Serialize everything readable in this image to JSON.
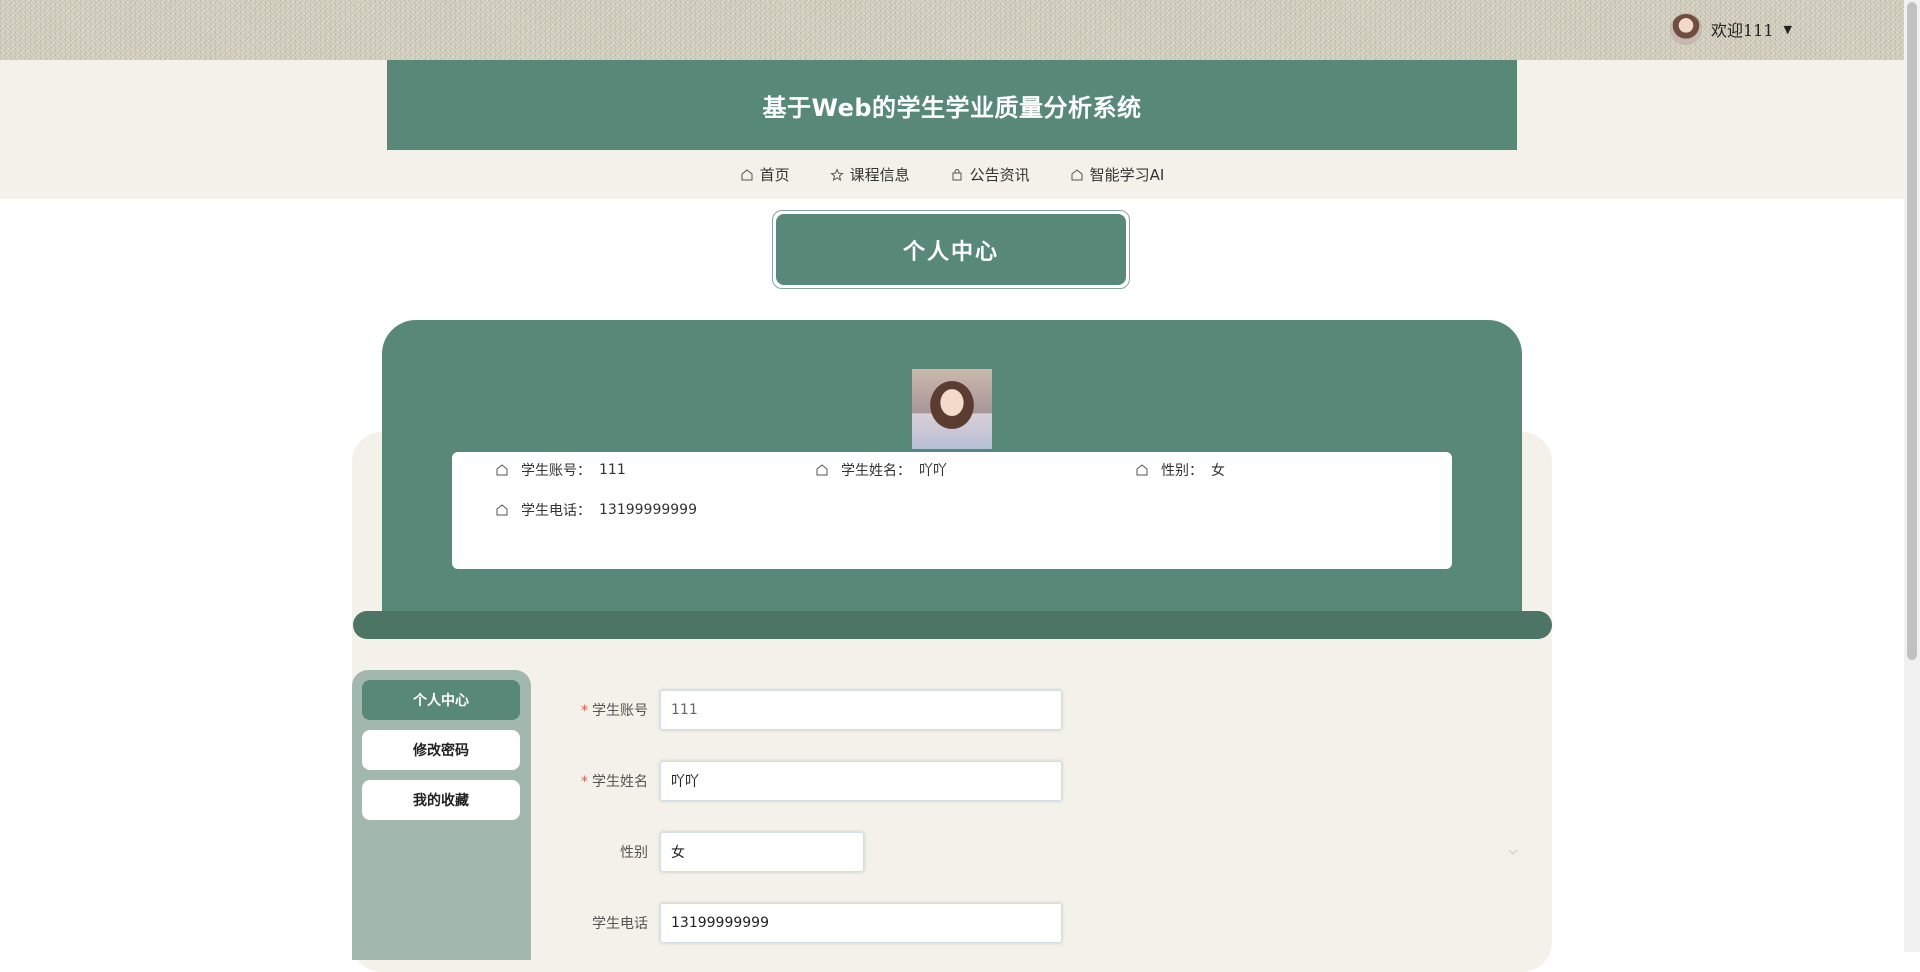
{
  "header": {
    "welcome_text": "欢迎111",
    "site_title": "基于Web的学生学业质量分析系统"
  },
  "nav": {
    "items": [
      {
        "label": "首页",
        "icon": "home-icon"
      },
      {
        "label": "课程信息",
        "icon": "star-icon"
      },
      {
        "label": "公告资讯",
        "icon": "bag-icon"
      },
      {
        "label": "智能学习AI",
        "icon": "home-icon"
      }
    ]
  },
  "page": {
    "title": "个人中心"
  },
  "profile": {
    "fields": [
      {
        "label": "学生账号：",
        "value": "111"
      },
      {
        "label": "学生姓名：",
        "value": "吖吖"
      },
      {
        "label": "性别：",
        "value": "女"
      },
      {
        "label": "学生电话：",
        "value": "13199999999"
      }
    ]
  },
  "sidebar": {
    "items": [
      {
        "label": "个人中心",
        "active": true
      },
      {
        "label": "修改密码",
        "active": false
      },
      {
        "label": "我的收藏",
        "active": false
      }
    ]
  },
  "form": {
    "account": {
      "label": "学生账号",
      "required": "*",
      "value": "111"
    },
    "name": {
      "label": "学生姓名",
      "required": "*",
      "value": "吖吖"
    },
    "gender": {
      "label": "性别",
      "value": "女"
    },
    "phone": {
      "label": "学生电话",
      "value": "13199999999"
    }
  },
  "colors": {
    "primary": "#588878",
    "sidebar_bg": "#a2b8af",
    "section_bg": "#f3f1e9",
    "required_mark": "#e05a4d"
  }
}
